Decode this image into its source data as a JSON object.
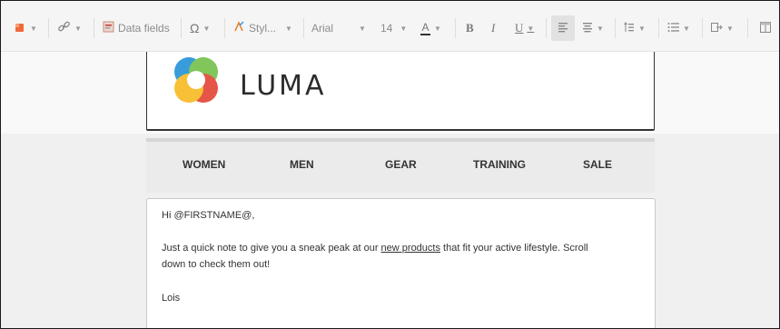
{
  "toolbar": {
    "data_fields_label": "Data fields",
    "omega_label": "Ω",
    "styles_label": "Styl...",
    "font_family": "Arial",
    "font_size": "14",
    "font_color_letter": "A",
    "bold_label": "B",
    "italic_label": "I",
    "underline_label": "U"
  },
  "logo": {
    "text": "LUMA"
  },
  "nav": {
    "items": [
      "WOMEN",
      "MEN",
      "GEAR",
      "TRAINING",
      "SALE"
    ]
  },
  "email": {
    "greeting": "Hi @FIRSTNAME@,",
    "para_before": "Just a quick note to give you a sneak peak at our ",
    "link_text": "new products",
    "para_after": " that fit your active lifestyle.  Scroll",
    "para_line2": "down to check them out!",
    "signature": "Lois"
  },
  "colors": {
    "logo_blue": "#1e8fd6",
    "logo_green": "#6fbf44",
    "logo_red": "#e23e2f",
    "logo_yellow": "#f7b81c"
  }
}
